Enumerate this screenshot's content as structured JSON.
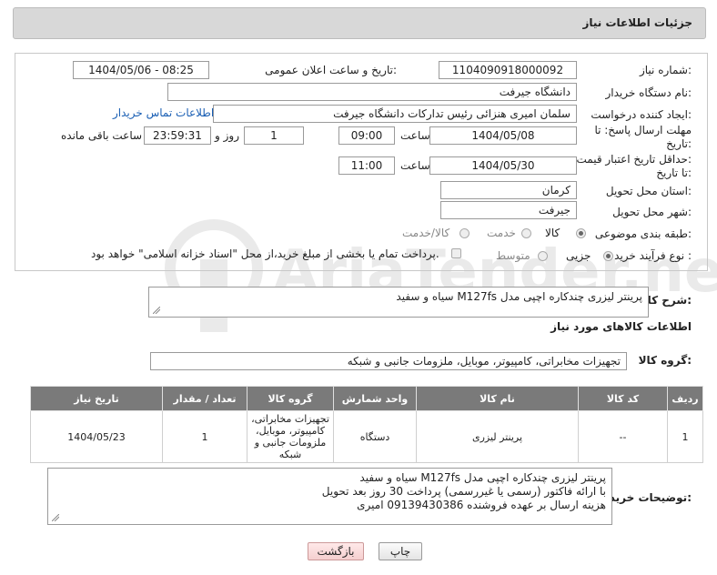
{
  "header": {
    "title": "جزئیات اطلاعات نیاز"
  },
  "labels": {
    "need_number": "شماره نیاز:",
    "announce_date": "تاریخ و ساعت اعلان عمومی:",
    "buyer_org": "نام دستگاه خریدار:",
    "requester": "ایجاد کننده درخواست:",
    "deadline": "مهلت ارسال پاسخ: تا تاریخ:",
    "deadline_line1": "مهلت ارسال پاسخ: تا",
    "deadline_line2": "تاریخ:",
    "hour": "ساعت",
    "day_and": "روز و",
    "remaining": "ساعت باقی مانده",
    "min_price_line1": "حداقل تاریخ اعتبار قیمت:",
    "min_price_line2": "تا تاریخ:",
    "province": "استان محل تحویل:",
    "city": "شهر محل تحویل:",
    "category": "طبقه بندی موضوعی:",
    "process": "نوع فرآیند خرید :",
    "description": "شرح کلی نیاز:",
    "goods_info": "اطلاعات کالاهای مورد نیاز",
    "goods_group": "گروه کالا:",
    "buyer_notes": "توضیحات خریدار:"
  },
  "values": {
    "need_number": "1104090918000092",
    "announce_date": "1404/05/06 - 08:25",
    "buyer_org": "دانشگاه جیرفت",
    "requester": "سلمان امیری هنزائی رئیس تدارکات دانشگاه جیرفت",
    "contact_link": "اطلاعات تماس خریدار",
    "deadline_date": "1404/05/08",
    "deadline_time": "09:00",
    "days": "1",
    "remaining_time": "23:59:31",
    "price_date": "1404/05/30",
    "price_time": "11:00",
    "province": "کرمان",
    "city": "جیرفت",
    "description": "پرینتر لیزری چندکاره اچپی مدل M127fs سیاه و سفید",
    "goods_group": "تجهیزات مخابراتی، کامپیوتر، موبایل، ملزومات جانبی و شبکه"
  },
  "category_options": [
    {
      "label": "کالا",
      "selected": true
    },
    {
      "label": "خدمت",
      "selected": false
    },
    {
      "label": "کالا/خدمت",
      "selected": false
    }
  ],
  "process_options": [
    {
      "label": "جزیی",
      "selected": true
    },
    {
      "label": "متوسط",
      "selected": false
    }
  ],
  "process_note": "پرداخت تمام یا بخشی از مبلغ خرید،از محل \"اسناد خزانه اسلامی\" خواهد بود.",
  "table": {
    "headers": [
      "ردیف",
      "کد کالا",
      "نام کالا",
      "واحد شمارش",
      "گروه کالا",
      "تعداد / مقدار",
      "تاریخ نیاز"
    ],
    "rows": [
      [
        "1",
        "--",
        "پرینتر لیزری",
        "دستگاه",
        "تجهیزات مخابراتی، کامپیوتر، موبایل، ملزومات جانبی و شبکه",
        "1",
        "1404/05/23"
      ]
    ]
  },
  "buyer_notes_lines": [
    "پرینتر لیزری چندکاره اچپی مدل M127fs سیاه و سفید",
    "با ارائه فاکتور (رسمی یا غیررسمی) پرداخت 30 روز بعد تحویل",
    "هزینه ارسال بر عهده فروشنده 09139430386 امیری"
  ],
  "buttons": {
    "print": "چاپ",
    "back": "بازگشت"
  },
  "watermark_text": "AriaTender.neT",
  "colors": {
    "header_bg": "#d8d8d8",
    "table_header": "#7a7a7a",
    "link": "#1a5fb4"
  }
}
